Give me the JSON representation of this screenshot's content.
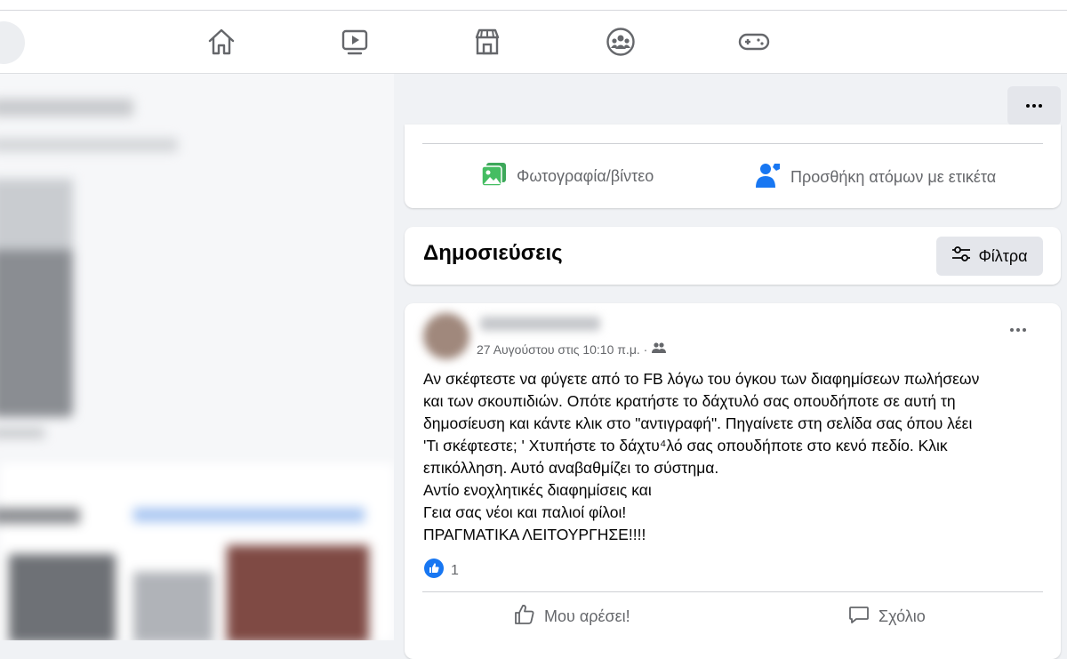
{
  "nav": {
    "icons": [
      "home-icon",
      "watch-icon",
      "marketplace-icon",
      "groups-icon",
      "gaming-icon"
    ]
  },
  "composer": {
    "photo_label": "Φωτογραφία/βίντεο",
    "tag_label": "Προσθήκη ατόμων με ετικέτα"
  },
  "posts_header": {
    "title": "Δημοσιεύσεις",
    "filter_label": "Φίλτρα"
  },
  "post": {
    "timestamp": "27 Αυγούστου στις 10:10 π.μ. ·",
    "lines": [
      "Αν σκέφτεστε να φύγετε από το FB λόγω του όγκου των διαφημίσεων πωλήσεων",
      "και των σκουπιδιών. Οπότε κρατήστε το δάχτυλό σας οπουδήποτε σε αυτή τη",
      "δημοσίευση και κάντε κλικ στο \"αντιγραφή\". Πηγαίνετε στη σελίδα σας όπου λέει",
      "'Τι σκέφτεστε; ' Χτυπήστε το δάχτυ⁴λό σας οπουδήποτε στο κενό πεδίο. Κλικ",
      "επικόλληση. Αυτό αναβαθμίζει το σύστημα.",
      "Αντίο ενοχλητικές διαφημίσεις και",
      "Γεια σας νέοι και παλιοί φίλοι!",
      "ΠΡΑΓΜΑΤΙΚΑ ΛΕΙΤΟΥΡΓΗΣΕ!!!!"
    ],
    "reaction_count": "1",
    "like_label": "Μου αρέσει!",
    "comment_label": "Σχόλιο"
  },
  "colors": {
    "accent": "#1877f2",
    "photo_green": "#45bd62",
    "icon_grey": "#65676b"
  }
}
